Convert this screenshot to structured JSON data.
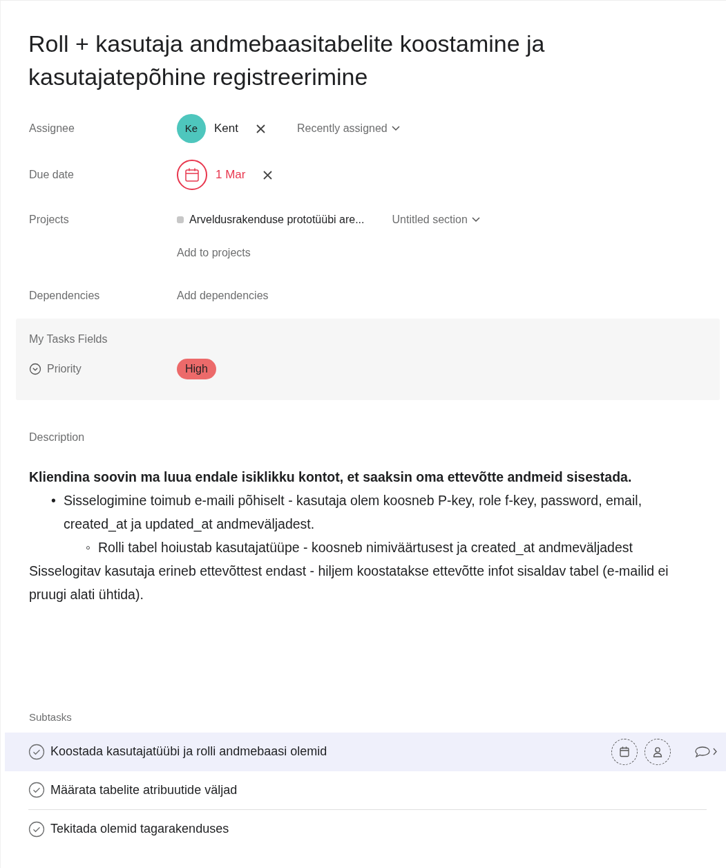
{
  "title": "Roll + kasutaja andmebaasitabelite koostamine ja kasutajatepõhine registreerimine",
  "fields": [
    {
      "kind": "assignee",
      "label": "Assignee",
      "initials": "Ke",
      "color": "#4ec6bd",
      "value": "Kent",
      "extra": "Recently assigned"
    },
    {
      "kind": "due",
      "label": "Due date",
      "value": "1 Mar"
    },
    {
      "kind": "projects",
      "label": "Projects",
      "project": "Arveldusrakenduse prototüübi are...",
      "color": "#c7c7c7",
      "section": "Untitled section",
      "add": "Add to projects"
    },
    {
      "kind": "dependencies",
      "label": "Dependencies",
      "add": "Add dependencies"
    }
  ],
  "custom_fields": {
    "title": "My Tasks Fields",
    "items": [
      {
        "label": "Priority",
        "value": "High",
        "color": "#ec6a6a"
      }
    ]
  },
  "description": {
    "label": "Description",
    "blocks": [
      {
        "kind": "bold",
        "text": "Kliendina soovin ma luua endale isiklikku kontot, et saaksin oma ettevõtte andmeid sisestada."
      },
      {
        "kind": "bullet",
        "marker": "•",
        "text": "Sisselogimine toimub e-maili põhiselt - kasutaja olem koosneb P-key, role f-key, password, email, created_at ja updated_at andmeväljadest.",
        "children": [
          {
            "kind": "bullet",
            "marker": "◦",
            "text": "Rolli tabel hoiustab kasutajatüüpe - koosneb nimiväärtusest ja created_at andmeväljadest"
          }
        ]
      },
      {
        "kind": "plain",
        "text": "Sisselogitav kasutaja erineb ettevõttest endast - hiljem koostatakse ettevõtte infot sisaldav tabel (e-mailid ei pruugi alati ühtida)."
      }
    ]
  },
  "subtasks": {
    "label": "Subtasks",
    "items": [
      {
        "text": "Koostada kasutajatüübi ja rolli andmebaasi olemid",
        "highlighted": true
      },
      {
        "text": "Määrata tabelite atribuutide väljad",
        "highlighted": false
      },
      {
        "text": "Tekitada olemid tagarakenduses",
        "highlighted": false
      }
    ]
  }
}
